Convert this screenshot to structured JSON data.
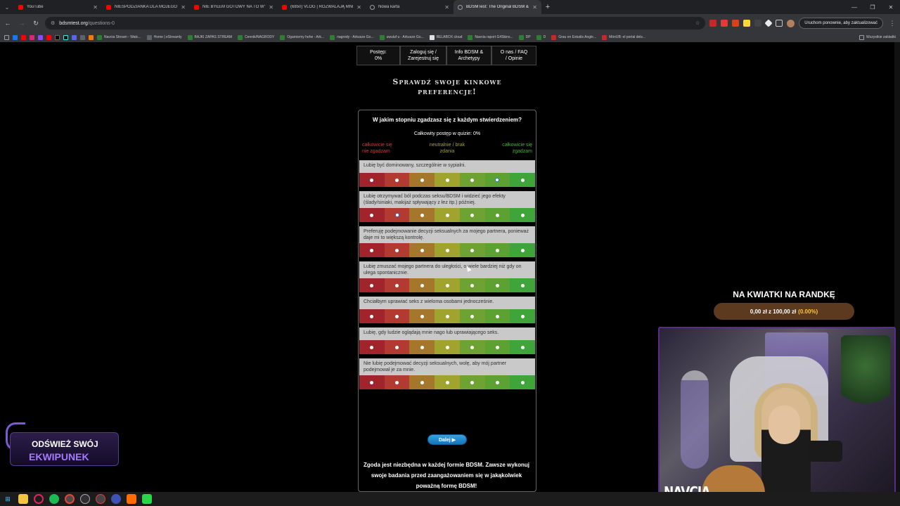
{
  "browser": {
    "tabs": [
      {
        "title": "YouTube",
        "favicon": "youtube-icon",
        "active": false
      },
      {
        "title": "NIESPODZIANKA DLA MOJEGO M",
        "favicon": "youtube-icon",
        "active": false
      },
      {
        "title": "NIE BYŁEM GOTOWY NA TO WYZW",
        "favicon": "youtube-icon",
        "active": false
      },
      {
        "title": "(6850) VLOG | ROZWALAJĄ MNIE",
        "favicon": "youtube-icon",
        "active": false
      },
      {
        "title": "Nowa karta",
        "favicon": "globe-icon",
        "active": false
      },
      {
        "title": "BDSMTest: The Original BDSM &",
        "favicon": "globe-icon",
        "active": true
      }
    ],
    "address": {
      "domain": "bdsmtest.org",
      "path": "/questions-0"
    },
    "relaunch_label": "Uruchom ponownie, aby zaktualizować",
    "bookmarks": [
      "Navcia Stream - Watc...",
      "Home | eStreamly",
      "BAJKI ZAPAS STREAM",
      "Cennik/NAGRODY",
      "Ogarniemy hehe - Ark...",
      "nagrody - Arkusze Go...",
      "uwuluf u - Arkusze Go...",
      "BELABOX cloud",
      "Navcia raport G4Skins...",
      "DP",
      "D",
      "Grau en Estudis Angle...",
      "MónUB: el portal dels..."
    ],
    "all_bookmarks_label": "Wszystkie zakładki"
  },
  "site": {
    "menu": [
      {
        "line1": "Postęp:",
        "line2": "0%"
      },
      {
        "line1": "Zaloguj się /",
        "line2": "Zarejestruj się"
      },
      {
        "line1": "Info BDSM &",
        "line2": "Archetypy"
      },
      {
        "line1": "O nas / FAQ",
        "line2": "/ Opinie"
      }
    ],
    "headline_1": "Sprawdź swoje kinkowe",
    "headline_2": "preferencje!",
    "quiz": {
      "question": "W jakim stopniu zgadzasz się z każdym stwierdzeniem?",
      "progress": "Całkowity postęp w quizie: 0%",
      "scale_left_1": "całkowicie się",
      "scale_left_2": "nie zgadzam",
      "scale_mid_1": "neutralnie / brak",
      "scale_mid_2": "zdania",
      "scale_right_1": "całkowicie się",
      "scale_right_2": "zgadzam",
      "statements": [
        {
          "text": "Lubię być dominowany, szczególnie w sypialni.",
          "selected": 6
        },
        {
          "text": "Lubię otrzymywać ból podczas seksu/BDSM i widzieć jego efekty (ślady/siniaki, makijaż spływający z łez itp.) później.",
          "selected": 2
        },
        {
          "text": "Preferuję podejmowanie decyzji seksualnych za mojego partnera, ponieważ daje mi to większą kontrolę.",
          "selected": 0
        },
        {
          "text": "Lubię zmuszać mojego partnera do uległości, o wiele bardziej niż gdy on ulega spontanicznie.",
          "selected": 0
        },
        {
          "text": "Chciałbym uprawiać seks z wieloma osobami jednocześnie.",
          "selected": 0
        },
        {
          "text": "Lubię, gdy ludzie oglądają mnie nago lub uprawiającego seks.",
          "selected": 0
        },
        {
          "text": "Nie lubię podejmować decyzji seksualnych, wolę, aby mój partner podejmował je za mnie.",
          "selected": 0
        }
      ],
      "next_label": "Dalej ▶",
      "consent": "Zgoda jest niezbędna w każdej formie BDSM. Zawsze wykonuj swoje badania przed zaangażowaniem się w jakąkolwiek poważną formę BDSM!"
    }
  },
  "stream_overlay": {
    "goal_title": "NA KWIATKI NA RANDKĘ",
    "goal_amount": "0,00 zł z 100,00 zł",
    "goal_percent": "(0.00%)",
    "goal_progress": 0,
    "camera_name": "NAVCIA",
    "promo_line1": "ODŚWIEŻ SWÓJ",
    "promo_line2": "EKWIPUNEK"
  },
  "colors": {
    "scale": [
      "#a1232b",
      "#b33a30",
      "#a4772c",
      "#a1a32f",
      "#6ea232",
      "#5ba233",
      "#3fa43a"
    ],
    "selected_radio": "#2d72d9",
    "next_button": "#1672b8"
  }
}
